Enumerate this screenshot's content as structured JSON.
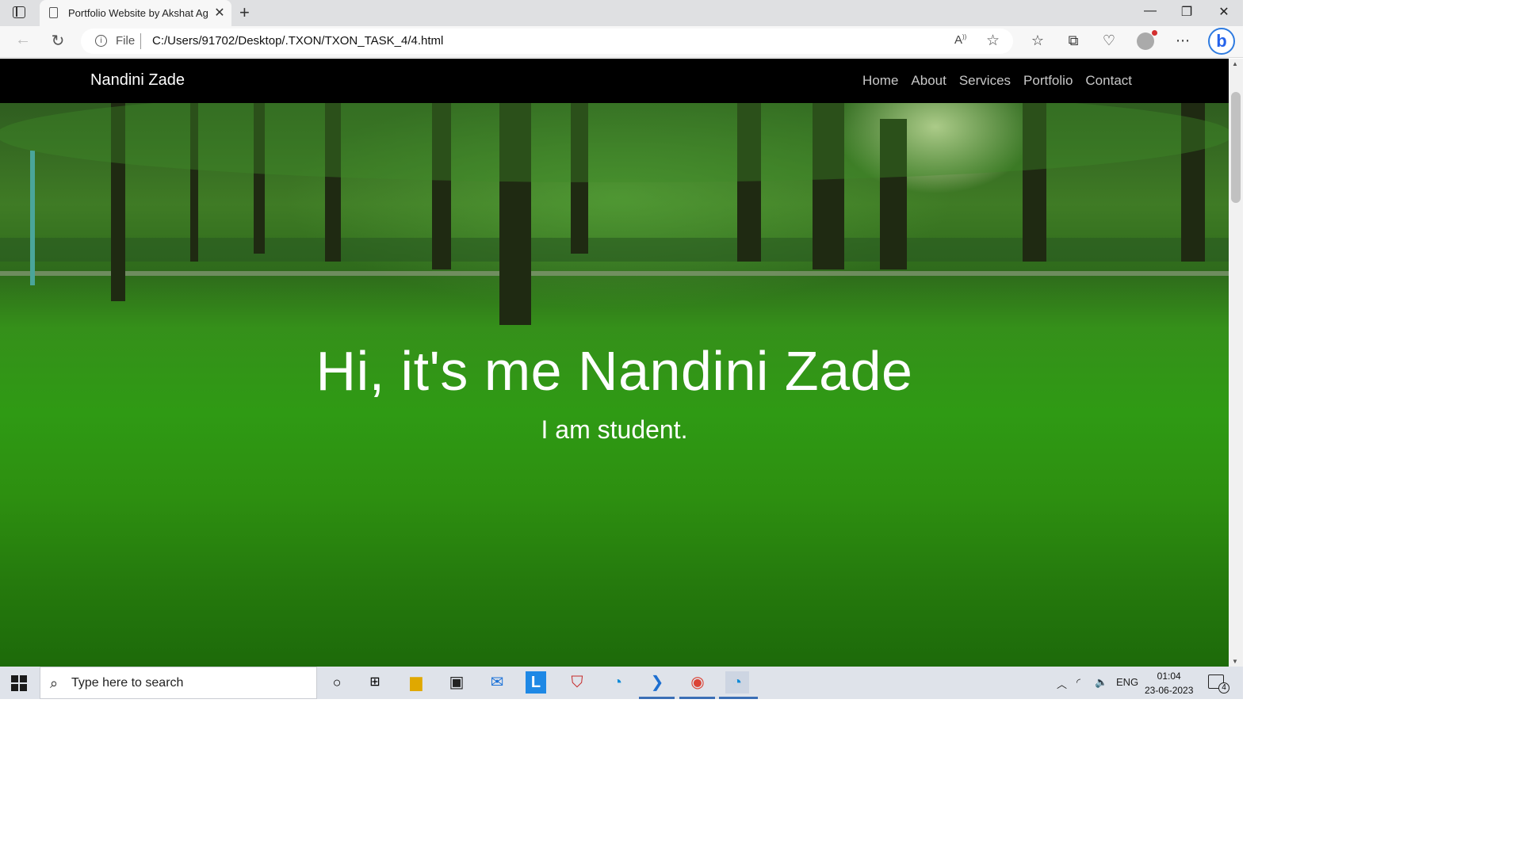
{
  "browser": {
    "tab_title": "Portfolio Website by Akshat Agrawal",
    "tab_close": "✕",
    "new_tab": "+",
    "url_scheme_label": "File",
    "url": "C:/Users/91702/Desktop/.TXON/TXON_TASK_4/4.html",
    "window_controls": [
      "—",
      "❐",
      "✕"
    ]
  },
  "site": {
    "brand": "Nandini Zade",
    "menu": [
      "Home",
      "About",
      "Services",
      "Portfolio",
      "Contact"
    ],
    "hero_title": "Hi, it's me Nandini Zade",
    "hero_subtitle": "I am student."
  },
  "taskbar": {
    "search_placeholder": "Type here to search",
    "language": "ENG",
    "time": "01:04",
    "date": "23-06-2023",
    "notification_count": "4"
  },
  "colors": {
    "nav_bg": "#000000",
    "grass": "#2f9a14",
    "accent": "#2e7be0"
  }
}
